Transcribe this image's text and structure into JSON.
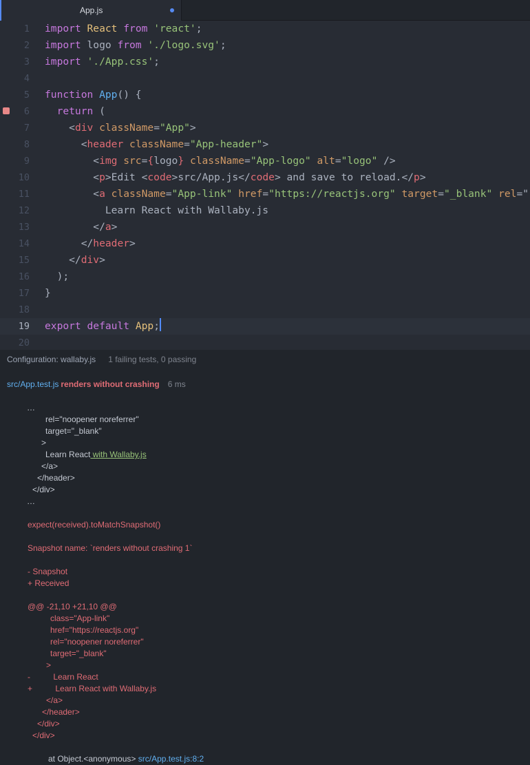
{
  "tab": {
    "title": "App.js",
    "modified_indicator": "●"
  },
  "editor": {
    "cursor_line": 19,
    "error_marker_line": 6,
    "lines": [
      {
        "n": "1",
        "tokens": [
          {
            "t": "import",
            "c": "kw"
          },
          {
            "t": " "
          },
          {
            "t": "React",
            "c": "cls"
          },
          {
            "t": " "
          },
          {
            "t": "from",
            "c": "kw"
          },
          {
            "t": " "
          },
          {
            "t": "'react'",
            "c": "str"
          },
          {
            "t": ";"
          }
        ]
      },
      {
        "n": "2",
        "tokens": [
          {
            "t": "import",
            "c": "kw"
          },
          {
            "t": " logo "
          },
          {
            "t": "from",
            "c": "kw"
          },
          {
            "t": " "
          },
          {
            "t": "'./logo.svg'",
            "c": "str"
          },
          {
            "t": ";"
          }
        ]
      },
      {
        "n": "3",
        "tokens": [
          {
            "t": "import",
            "c": "kw"
          },
          {
            "t": " "
          },
          {
            "t": "'./App.css'",
            "c": "str"
          },
          {
            "t": ";"
          }
        ]
      },
      {
        "n": "4",
        "tokens": []
      },
      {
        "n": "5",
        "tokens": [
          {
            "t": "function",
            "c": "kw"
          },
          {
            "t": " "
          },
          {
            "t": "App",
            "c": "fn"
          },
          {
            "t": "() {"
          }
        ]
      },
      {
        "n": "6",
        "tokens": [
          {
            "t": "  "
          },
          {
            "t": "return",
            "c": "kw"
          },
          {
            "t": " ("
          }
        ]
      },
      {
        "n": "7",
        "tokens": [
          {
            "t": "    "
          },
          {
            "t": "<",
            "c": "plain"
          },
          {
            "t": "div",
            "c": "tag"
          },
          {
            "t": " "
          },
          {
            "t": "className",
            "c": "attr"
          },
          {
            "t": "="
          },
          {
            "t": "\"App\"",
            "c": "str"
          },
          {
            "t": ">"
          }
        ]
      },
      {
        "n": "8",
        "tokens": [
          {
            "t": "      <"
          },
          {
            "t": "header",
            "c": "tag"
          },
          {
            "t": " "
          },
          {
            "t": "className",
            "c": "attr"
          },
          {
            "t": "="
          },
          {
            "t": "\"App-header\"",
            "c": "str"
          },
          {
            "t": ">"
          }
        ]
      },
      {
        "n": "9",
        "tokens": [
          {
            "t": "        <"
          },
          {
            "t": "img",
            "c": "tag"
          },
          {
            "t": " "
          },
          {
            "t": "src",
            "c": "attr"
          },
          {
            "t": "="
          },
          {
            "t": "{",
            "c": "tag"
          },
          {
            "t": "logo"
          },
          {
            "t": "}",
            "c": "tag"
          },
          {
            "t": " "
          },
          {
            "t": "className",
            "c": "attr"
          },
          {
            "t": "="
          },
          {
            "t": "\"App-logo\"",
            "c": "str"
          },
          {
            "t": " "
          },
          {
            "t": "alt",
            "c": "attr"
          },
          {
            "t": "="
          },
          {
            "t": "\"logo\"",
            "c": "str"
          },
          {
            "t": " />"
          }
        ]
      },
      {
        "n": "10",
        "tokens": [
          {
            "t": "        <"
          },
          {
            "t": "p",
            "c": "tag"
          },
          {
            "t": ">Edit <"
          },
          {
            "t": "code",
            "c": "tag"
          },
          {
            "t": ">src/App.js</"
          },
          {
            "t": "code",
            "c": "tag"
          },
          {
            "t": "> and save to reload.</"
          },
          {
            "t": "p",
            "c": "tag"
          },
          {
            "t": ">"
          }
        ]
      },
      {
        "n": "11",
        "tokens": [
          {
            "t": "        <"
          },
          {
            "t": "a",
            "c": "tag"
          },
          {
            "t": " "
          },
          {
            "t": "className",
            "c": "attr"
          },
          {
            "t": "="
          },
          {
            "t": "\"App-link\"",
            "c": "str"
          },
          {
            "t": " "
          },
          {
            "t": "href",
            "c": "attr"
          },
          {
            "t": "="
          },
          {
            "t": "\"https://reactjs.org\"",
            "c": "str"
          },
          {
            "t": " "
          },
          {
            "t": "target",
            "c": "attr"
          },
          {
            "t": "="
          },
          {
            "t": "\"_blank\"",
            "c": "str"
          },
          {
            "t": " "
          },
          {
            "t": "rel",
            "c": "attr"
          },
          {
            "t": "=\""
          }
        ]
      },
      {
        "n": "12",
        "tokens": [
          {
            "t": "          Learn React with Wallaby.js"
          }
        ]
      },
      {
        "n": "13",
        "tokens": [
          {
            "t": "        </"
          },
          {
            "t": "a",
            "c": "tag"
          },
          {
            "t": ">"
          }
        ]
      },
      {
        "n": "14",
        "tokens": [
          {
            "t": "      </"
          },
          {
            "t": "header",
            "c": "tag"
          },
          {
            "t": ">"
          }
        ]
      },
      {
        "n": "15",
        "tokens": [
          {
            "t": "    </"
          },
          {
            "t": "div",
            "c": "tag"
          },
          {
            "t": ">"
          }
        ]
      },
      {
        "n": "16",
        "tokens": [
          {
            "t": "  );"
          }
        ]
      },
      {
        "n": "17",
        "tokens": [
          {
            "t": "}"
          }
        ]
      },
      {
        "n": "18",
        "tokens": []
      },
      {
        "n": "19",
        "tokens": [
          {
            "t": "export",
            "c": "kw"
          },
          {
            "t": " "
          },
          {
            "t": "default",
            "c": "kw"
          },
          {
            "t": " "
          },
          {
            "t": "App",
            "c": "cls"
          },
          {
            "t": ";"
          }
        ]
      },
      {
        "n": "20",
        "tokens": []
      }
    ]
  },
  "panel": {
    "configuration": "Configuration: wallaby.js",
    "summary": "1 failing tests, 0 passing",
    "test": {
      "file": "src/App.test.js",
      "name": "renders without crashing",
      "time": "6 ms"
    },
    "output": [
      {
        "i": 39,
        "c": "gray",
        "t": "…"
      },
      {
        "i": 66,
        "c": "gray",
        "t": "rel=\"noopener noreferrer\""
      },
      {
        "i": 66,
        "c": "gray",
        "t": "target=\"_blank\""
      },
      {
        "i": 60,
        "c": "gray",
        "t": ">"
      },
      {
        "i": 66,
        "segs": [
          {
            "c": "gray",
            "t": "Learn React"
          },
          {
            "c": "green-u",
            "t": " with Wallaby.js"
          }
        ]
      },
      {
        "i": 60,
        "c": "gray",
        "t": "</a>"
      },
      {
        "i": 54,
        "c": "gray",
        "t": "</header>"
      },
      {
        "i": 47,
        "c": "gray",
        "t": "</div>"
      },
      {
        "i": 39,
        "c": "gray",
        "t": "…"
      },
      {
        "i": 40,
        "c": "red",
        "t": ""
      },
      {
        "i": 40,
        "c": "red",
        "t": "expect(received).toMatchSnapshot()"
      },
      {
        "i": 40,
        "c": "red",
        "t": ""
      },
      {
        "i": 40,
        "c": "red",
        "t": "Snapshot name: `renders without crashing 1`"
      },
      {
        "i": 40,
        "c": "red",
        "t": ""
      },
      {
        "i": 40,
        "c": "red",
        "t": "- Snapshot"
      },
      {
        "i": 40,
        "c": "red",
        "t": "+ Received"
      },
      {
        "i": 40,
        "c": "red",
        "t": ""
      },
      {
        "i": 40,
        "c": "red",
        "t": "@@ -21,10 +21,10 @@"
      },
      {
        "i": 73,
        "c": "red",
        "t": "class=\"App-link\""
      },
      {
        "i": 73,
        "c": "red",
        "t": "href=\"https://reactjs.org\""
      },
      {
        "i": 73,
        "c": "red",
        "t": "rel=\"noopener noreferrer\""
      },
      {
        "i": 73,
        "c": "red",
        "t": "target=\"_blank\""
      },
      {
        "i": 67,
        "c": "red",
        "t": ">"
      },
      {
        "i": 40,
        "c": "red",
        "t": "-          Learn React"
      },
      {
        "i": 40,
        "c": "red",
        "t": "+          Learn React with Wallaby.js"
      },
      {
        "i": 67,
        "c": "red",
        "t": "</a>"
      },
      {
        "i": 61,
        "c": "red",
        "t": "</header>"
      },
      {
        "i": 54,
        "c": "red",
        "t": "</div>"
      },
      {
        "i": 47,
        "c": "red",
        "t": "</div>"
      },
      {
        "i": 40,
        "c": "red",
        "t": ""
      },
      {
        "i": 70,
        "segs": [
          {
            "c": "gray",
            "t": "at Object.<anonymous> "
          },
          {
            "c": "blue",
            "t": "src/App.test.js:8:2"
          }
        ]
      }
    ]
  },
  "colors": {
    "editor_bg": "#282c34",
    "panel_bg": "#21252b",
    "accent": "#568af2",
    "error": "#e06c75"
  }
}
